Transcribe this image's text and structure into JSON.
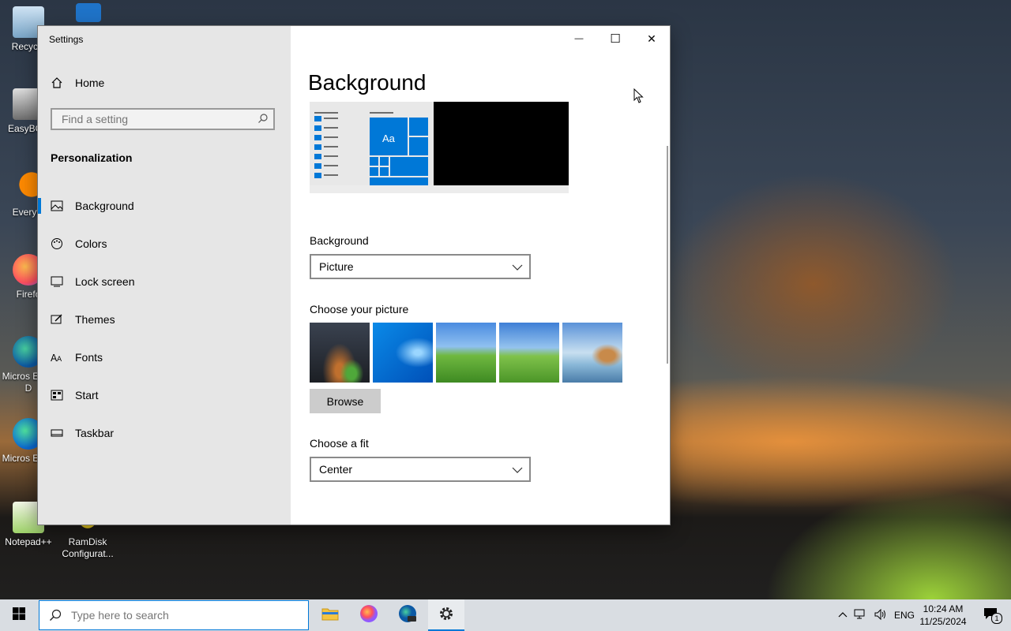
{
  "desktop": {
    "icons": [
      {
        "label": "Recycle"
      },
      {
        "label": "EasyBCD"
      },
      {
        "label": "Everyth"
      },
      {
        "label": "Firefo"
      },
      {
        "label": "Micros Edge D"
      },
      {
        "label": "Micros Edge"
      },
      {
        "label": "Notepad++"
      },
      {
        "label": "RamDisk Configurat..."
      }
    ]
  },
  "window": {
    "title": "Settings",
    "minimize_glyph": "—",
    "maximize_glyph": "☐",
    "close_glyph": "✕"
  },
  "sidebar": {
    "home_label": "Home",
    "search_placeholder": "Find a setting",
    "section_title": "Personalization",
    "items": [
      {
        "label": "Background",
        "icon": "picture-icon",
        "selected": true
      },
      {
        "label": "Colors",
        "icon": "palette-icon"
      },
      {
        "label": "Lock screen",
        "icon": "lock-screen-icon"
      },
      {
        "label": "Themes",
        "icon": "themes-icon"
      },
      {
        "label": "Fonts",
        "icon": "fonts-icon"
      },
      {
        "label": "Start",
        "icon": "start-icon"
      },
      {
        "label": "Taskbar",
        "icon": "taskbar-icon"
      }
    ]
  },
  "content": {
    "title": "Background",
    "preview_tile_label": "Aa",
    "background_label": "Background",
    "background_value": "Picture",
    "choose_picture_label": "Choose your picture",
    "browse_label": "Browse",
    "choose_fit_label": "Choose a fit",
    "fit_value": "Center"
  },
  "taskbar": {
    "search_placeholder": "Type here to search",
    "language": "ENG",
    "time": "10:24 AM",
    "date": "11/25/2024",
    "notification_count": "1"
  },
  "colors": {
    "accent": "#0078d7",
    "sidebar_bg": "#e6e6e6",
    "taskbar_bg": "#d9dde2"
  }
}
